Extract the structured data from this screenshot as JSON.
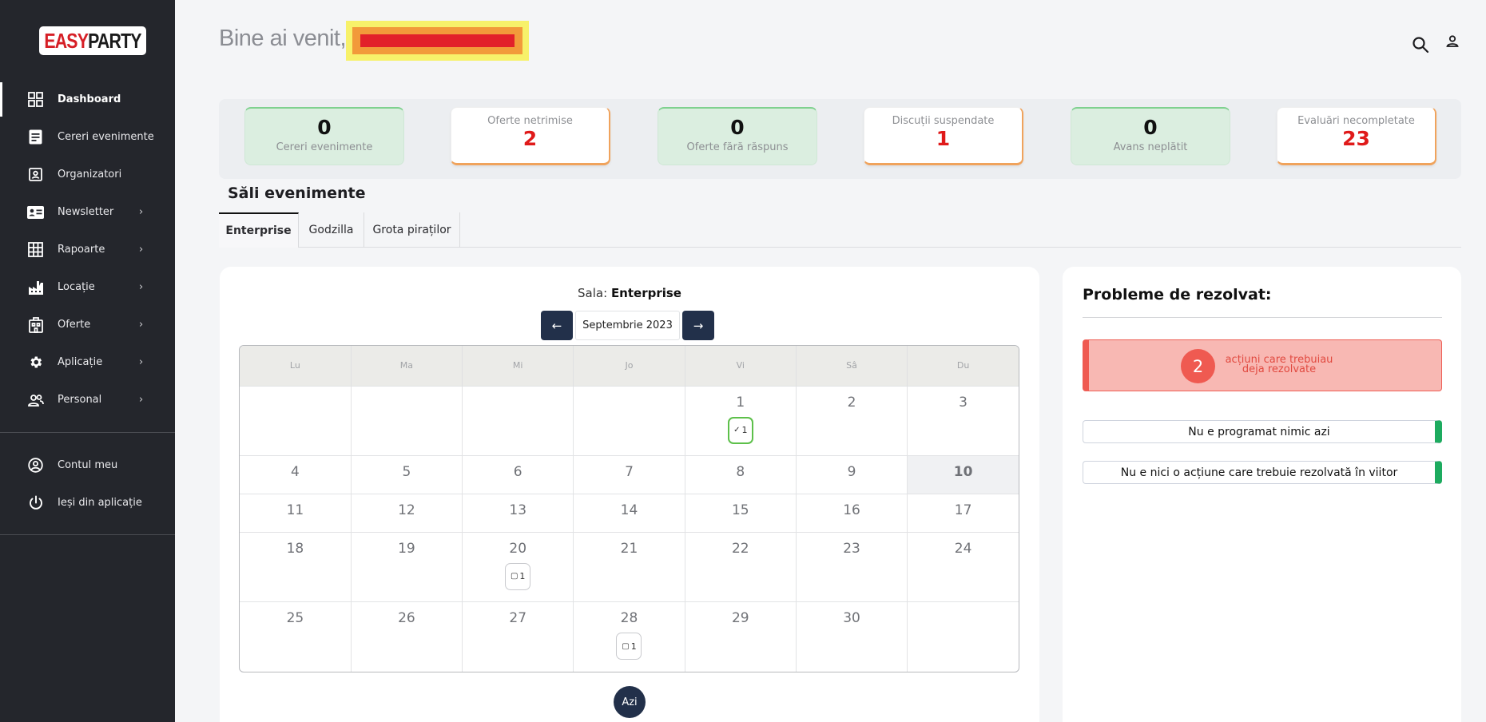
{
  "sidebar": {
    "logo": {
      "easy": "EASY",
      "party": "PARTY"
    },
    "items": [
      {
        "label": "Dashboard",
        "icon": "dashboard-icon"
      },
      {
        "label": "Cereri evenimente",
        "icon": "document-icon"
      },
      {
        "label": "Organizatori",
        "icon": "contact-card-icon"
      },
      {
        "label": "Newsletter",
        "icon": "id-card-icon"
      },
      {
        "label": "Rapoarte",
        "icon": "grid-icon"
      },
      {
        "label": "Locație",
        "icon": "factory-icon"
      },
      {
        "label": "Oferte",
        "icon": "building-icon"
      },
      {
        "label": "Aplicație",
        "icon": "gear-icon"
      },
      {
        "label": "Personal",
        "icon": "people-icon"
      }
    ],
    "chevron": "›",
    "account": [
      {
        "label": "Contul meu",
        "icon": "user-circle-icon"
      },
      {
        "label": "Ieși din aplicație",
        "icon": "power-icon"
      }
    ]
  },
  "header": {
    "welcome": "Bine ai venit,",
    "icons": [
      "search-icon",
      "user-icon"
    ]
  },
  "stats": [
    {
      "value": "0",
      "label": "Cereri evenimente",
      "style": "green"
    },
    {
      "value": "2",
      "label": "Oferte netrimise",
      "style": "white"
    },
    {
      "value": "0",
      "label": "Oferte fără răspuns",
      "style": "green"
    },
    {
      "value": "1",
      "label": "Discuții suspendate",
      "style": "white"
    },
    {
      "value": "0",
      "label": "Avans neplătit",
      "style": "green"
    },
    {
      "value": "23",
      "label": "Evaluări necompletate",
      "style": "white"
    }
  ],
  "rooms": {
    "title": "Săli evenimente",
    "tabs": [
      "Enterprise",
      "Godzilla",
      "Grota piraților"
    ],
    "active_tab": "Enterprise"
  },
  "calendar": {
    "sala_label": "Sala:",
    "sala_name": "Enterprise",
    "month": "Septembrie 2023",
    "prev": "←",
    "next": "→",
    "weekdays": [
      "Lu",
      "Ma",
      "Mi",
      "Jo",
      "Vi",
      "Sâ",
      "Du"
    ],
    "weeks": [
      [
        "",
        "",
        "",
        "",
        "1",
        "2",
        "3"
      ],
      [
        "4",
        "5",
        "6",
        "7",
        "8",
        "9",
        "10"
      ],
      [
        "11",
        "12",
        "13",
        "14",
        "15",
        "16",
        "17"
      ],
      [
        "18",
        "19",
        "20",
        "21",
        "22",
        "23",
        "24"
      ],
      [
        "25",
        "26",
        "27",
        "28",
        "29",
        "30",
        ""
      ]
    ],
    "today": "10",
    "badges": [
      {
        "day": "1",
        "symbol": "✓",
        "count": "1",
        "type": "confirmed"
      },
      {
        "day": "20",
        "symbol": "▢",
        "count": "1",
        "type": "pending"
      },
      {
        "day": "28",
        "symbol": "▢",
        "count": "1",
        "type": "pending"
      }
    ],
    "today_button": "Azi"
  },
  "problems": {
    "title": "Probleme de rezolvat:",
    "alert_count": "2",
    "alert_text": "acțiuni care trebuiau deja rezolvate",
    "rows": [
      "Nu e programat nimic azi",
      "Nu e nici o acțiune care trebuie rezolvată în viitor"
    ]
  },
  "colors": {
    "sidebar_bg": "#24262c",
    "accent_red": "#e01a1a",
    "alert_bg": "#f8b8b3",
    "success_green": "#1dab5f",
    "nav_dark": "#22304a"
  }
}
